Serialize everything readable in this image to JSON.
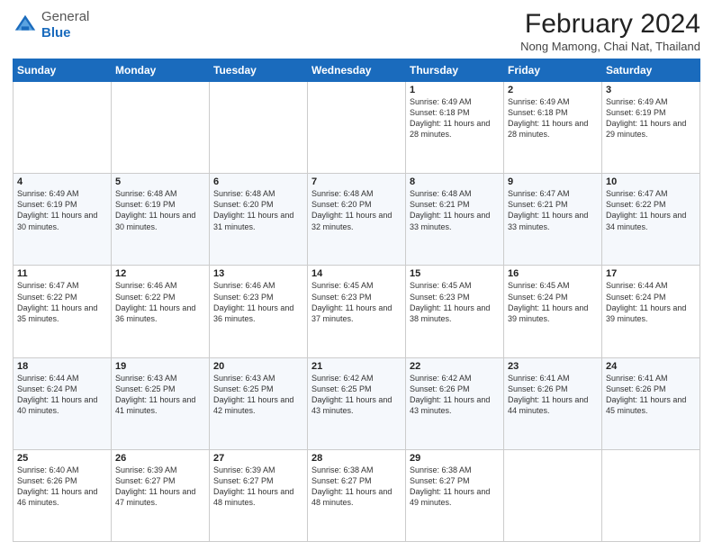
{
  "header": {
    "logo": {
      "general": "General",
      "blue": "Blue"
    },
    "title": "February 2024",
    "location": "Nong Mamong, Chai Nat, Thailand"
  },
  "days_of_week": [
    "Sunday",
    "Monday",
    "Tuesday",
    "Wednesday",
    "Thursday",
    "Friday",
    "Saturday"
  ],
  "weeks": [
    [
      {
        "day": "",
        "info": ""
      },
      {
        "day": "",
        "info": ""
      },
      {
        "day": "",
        "info": ""
      },
      {
        "day": "",
        "info": ""
      },
      {
        "day": "1",
        "info": "Sunrise: 6:49 AM\nSunset: 6:18 PM\nDaylight: 11 hours and 28 minutes."
      },
      {
        "day": "2",
        "info": "Sunrise: 6:49 AM\nSunset: 6:18 PM\nDaylight: 11 hours and 28 minutes."
      },
      {
        "day": "3",
        "info": "Sunrise: 6:49 AM\nSunset: 6:19 PM\nDaylight: 11 hours and 29 minutes."
      }
    ],
    [
      {
        "day": "4",
        "info": "Sunrise: 6:49 AM\nSunset: 6:19 PM\nDaylight: 11 hours and 30 minutes."
      },
      {
        "day": "5",
        "info": "Sunrise: 6:48 AM\nSunset: 6:19 PM\nDaylight: 11 hours and 30 minutes."
      },
      {
        "day": "6",
        "info": "Sunrise: 6:48 AM\nSunset: 6:20 PM\nDaylight: 11 hours and 31 minutes."
      },
      {
        "day": "7",
        "info": "Sunrise: 6:48 AM\nSunset: 6:20 PM\nDaylight: 11 hours and 32 minutes."
      },
      {
        "day": "8",
        "info": "Sunrise: 6:48 AM\nSunset: 6:21 PM\nDaylight: 11 hours and 33 minutes."
      },
      {
        "day": "9",
        "info": "Sunrise: 6:47 AM\nSunset: 6:21 PM\nDaylight: 11 hours and 33 minutes."
      },
      {
        "day": "10",
        "info": "Sunrise: 6:47 AM\nSunset: 6:22 PM\nDaylight: 11 hours and 34 minutes."
      }
    ],
    [
      {
        "day": "11",
        "info": "Sunrise: 6:47 AM\nSunset: 6:22 PM\nDaylight: 11 hours and 35 minutes."
      },
      {
        "day": "12",
        "info": "Sunrise: 6:46 AM\nSunset: 6:22 PM\nDaylight: 11 hours and 36 minutes."
      },
      {
        "day": "13",
        "info": "Sunrise: 6:46 AM\nSunset: 6:23 PM\nDaylight: 11 hours and 36 minutes."
      },
      {
        "day": "14",
        "info": "Sunrise: 6:45 AM\nSunset: 6:23 PM\nDaylight: 11 hours and 37 minutes."
      },
      {
        "day": "15",
        "info": "Sunrise: 6:45 AM\nSunset: 6:23 PM\nDaylight: 11 hours and 38 minutes."
      },
      {
        "day": "16",
        "info": "Sunrise: 6:45 AM\nSunset: 6:24 PM\nDaylight: 11 hours and 39 minutes."
      },
      {
        "day": "17",
        "info": "Sunrise: 6:44 AM\nSunset: 6:24 PM\nDaylight: 11 hours and 39 minutes."
      }
    ],
    [
      {
        "day": "18",
        "info": "Sunrise: 6:44 AM\nSunset: 6:24 PM\nDaylight: 11 hours and 40 minutes."
      },
      {
        "day": "19",
        "info": "Sunrise: 6:43 AM\nSunset: 6:25 PM\nDaylight: 11 hours and 41 minutes."
      },
      {
        "day": "20",
        "info": "Sunrise: 6:43 AM\nSunset: 6:25 PM\nDaylight: 11 hours and 42 minutes."
      },
      {
        "day": "21",
        "info": "Sunrise: 6:42 AM\nSunset: 6:25 PM\nDaylight: 11 hours and 43 minutes."
      },
      {
        "day": "22",
        "info": "Sunrise: 6:42 AM\nSunset: 6:26 PM\nDaylight: 11 hours and 43 minutes."
      },
      {
        "day": "23",
        "info": "Sunrise: 6:41 AM\nSunset: 6:26 PM\nDaylight: 11 hours and 44 minutes."
      },
      {
        "day": "24",
        "info": "Sunrise: 6:41 AM\nSunset: 6:26 PM\nDaylight: 11 hours and 45 minutes."
      }
    ],
    [
      {
        "day": "25",
        "info": "Sunrise: 6:40 AM\nSunset: 6:26 PM\nDaylight: 11 hours and 46 minutes."
      },
      {
        "day": "26",
        "info": "Sunrise: 6:39 AM\nSunset: 6:27 PM\nDaylight: 11 hours and 47 minutes."
      },
      {
        "day": "27",
        "info": "Sunrise: 6:39 AM\nSunset: 6:27 PM\nDaylight: 11 hours and 48 minutes."
      },
      {
        "day": "28",
        "info": "Sunrise: 6:38 AM\nSunset: 6:27 PM\nDaylight: 11 hours and 48 minutes."
      },
      {
        "day": "29",
        "info": "Sunrise: 6:38 AM\nSunset: 6:27 PM\nDaylight: 11 hours and 49 minutes."
      },
      {
        "day": "",
        "info": ""
      },
      {
        "day": "",
        "info": ""
      }
    ]
  ]
}
